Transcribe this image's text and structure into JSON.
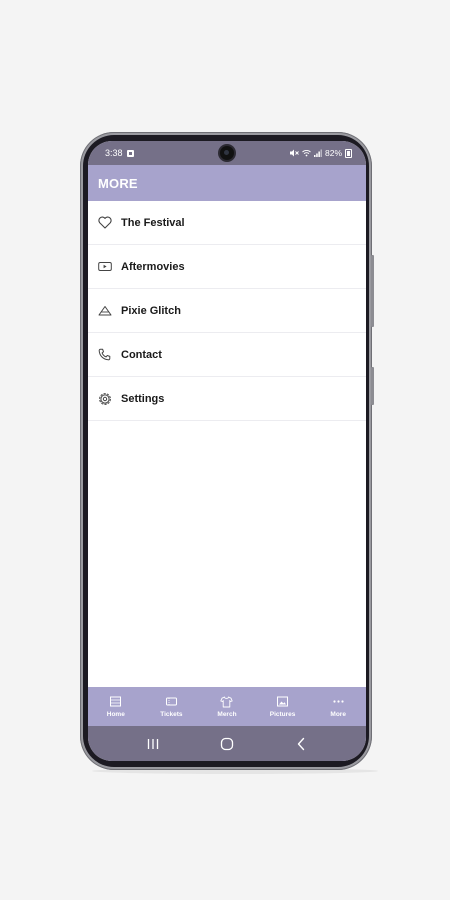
{
  "status_bar": {
    "time": "3:38",
    "battery": "82%"
  },
  "header": {
    "title": "MORE"
  },
  "menu": {
    "items": [
      {
        "label": "The Festival",
        "icon": "heart-icon"
      },
      {
        "label": "Aftermovies",
        "icon": "video-icon"
      },
      {
        "label": "Pixie Glitch",
        "icon": "mountain-icon"
      },
      {
        "label": "Contact",
        "icon": "phone-icon"
      },
      {
        "label": "Settings",
        "icon": "gear-icon"
      }
    ]
  },
  "bottom_nav": {
    "items": [
      {
        "label": "Home",
        "icon": "home-icon"
      },
      {
        "label": "Tickets",
        "icon": "ticket-icon"
      },
      {
        "label": "Merch",
        "icon": "tshirt-icon"
      },
      {
        "label": "Pictures",
        "icon": "image-icon"
      },
      {
        "label": "More",
        "icon": "more-dots-icon"
      }
    ]
  },
  "colors": {
    "accent": "#a7a3cc",
    "system_bar": "#757088",
    "background": "#f4f4f4"
  }
}
